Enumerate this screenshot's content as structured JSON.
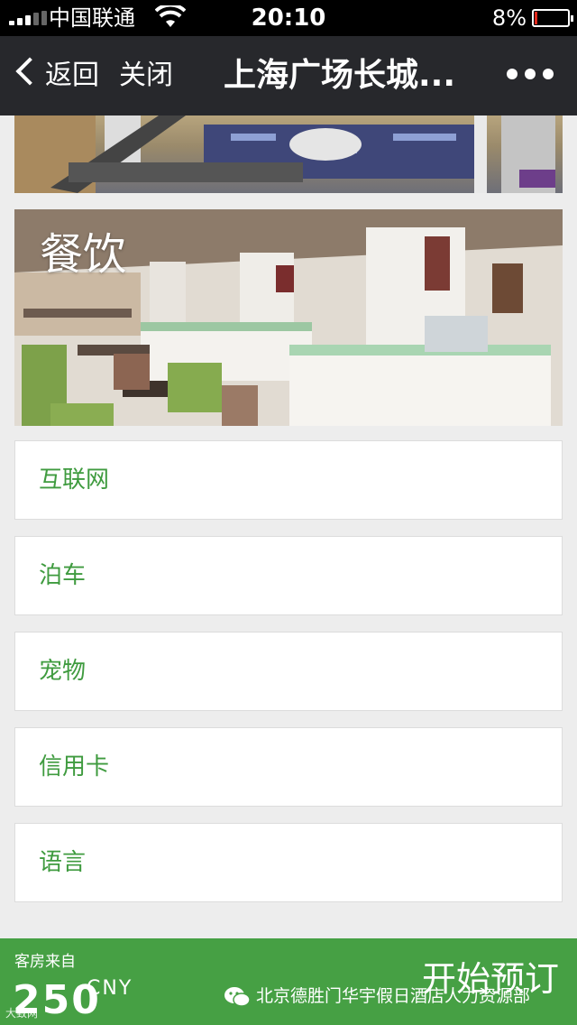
{
  "status_bar": {
    "carrier": "中国联通",
    "time": "20:10",
    "battery": "8%",
    "battery_level": 0.08
  },
  "nav": {
    "back_label": "返回",
    "close_label": "关闭",
    "title": "上海广场长城...",
    "more_icon": "more-dots-icon"
  },
  "sections": {
    "dining_title": "餐饮"
  },
  "amenities": [
    {
      "label": "互联网"
    },
    {
      "label": "泊车"
    },
    {
      "label": "宠物"
    },
    {
      "label": "信用卡"
    },
    {
      "label": "语言"
    }
  ],
  "booking": {
    "price_caption": "客房来自",
    "price_value": "250",
    "currency": "CNY",
    "button_label": "开始预订",
    "watermark_text": "北京德胜门华宇假日酒店人力资源部",
    "watermark_corner": "大致网",
    "accent_color": "#46a044"
  }
}
